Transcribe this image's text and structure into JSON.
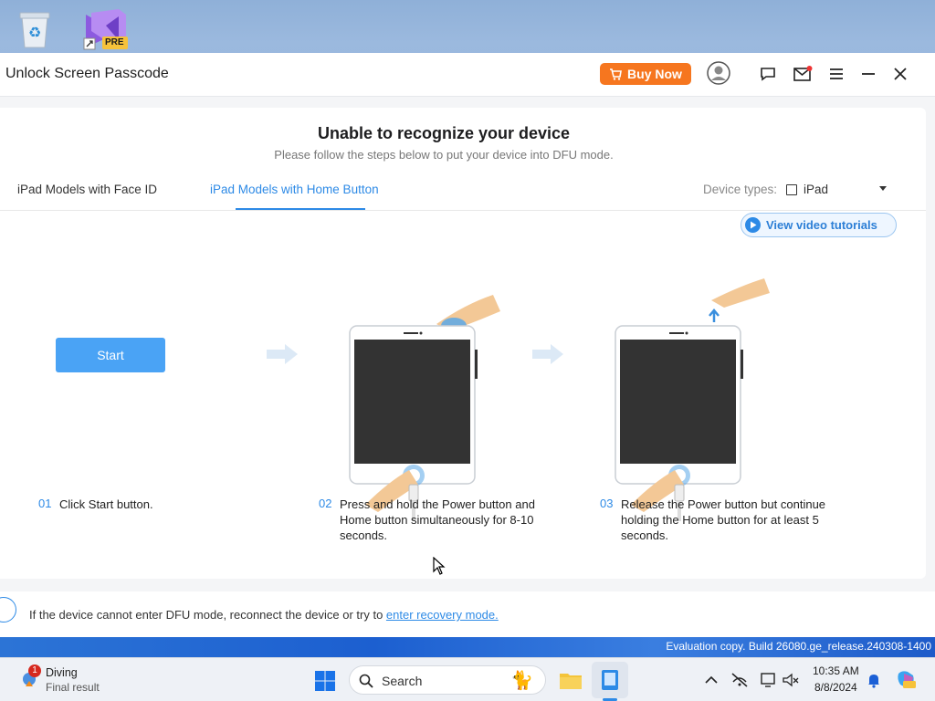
{
  "desktop": {
    "icons": [
      {
        "name": "Recycle Bin"
      },
      {
        "name": "Visual Studio Preview",
        "badge": "PRE"
      }
    ]
  },
  "window": {
    "title": "Unlock Screen Passcode",
    "buy_now": "Buy Now",
    "heading": "Unable to recognize your device",
    "subheading": "Please follow the steps below to put your device into DFU mode.",
    "tabs": [
      {
        "label": "iPad Models with Face ID",
        "active": false
      },
      {
        "label": "iPad Models with Home Button",
        "active": true
      }
    ],
    "device_types": {
      "label": "Device types:",
      "value": "iPad"
    },
    "video_tutorials": "View video tutorials",
    "start_button": "Start",
    "steps": [
      {
        "num": "01",
        "text": "Click Start button."
      },
      {
        "num": "02",
        "text": "Press and hold the Power button and Home button simultaneously for 8-10 seconds."
      },
      {
        "num": "03",
        "text": "Release the Power button but continue holding the Home button for at least 5 seconds."
      }
    ],
    "footer": {
      "text": "If the device cannot enter DFU mode, reconnect the device or try to ",
      "link": "enter recovery mode."
    }
  },
  "evaluation_watermark": "Evaluation copy. Build 26080.ge_release.240308-1400",
  "taskbar": {
    "widget": {
      "title": "Diving",
      "subtitle": "Final result",
      "badge": "1"
    },
    "search_placeholder": "Search",
    "clock": {
      "time": "10:35 AM",
      "date": "8/8/2024"
    }
  },
  "colors": {
    "accent": "#2d8ae6",
    "buy_now": "#f6761f",
    "start_button": "#4aa3f5"
  }
}
